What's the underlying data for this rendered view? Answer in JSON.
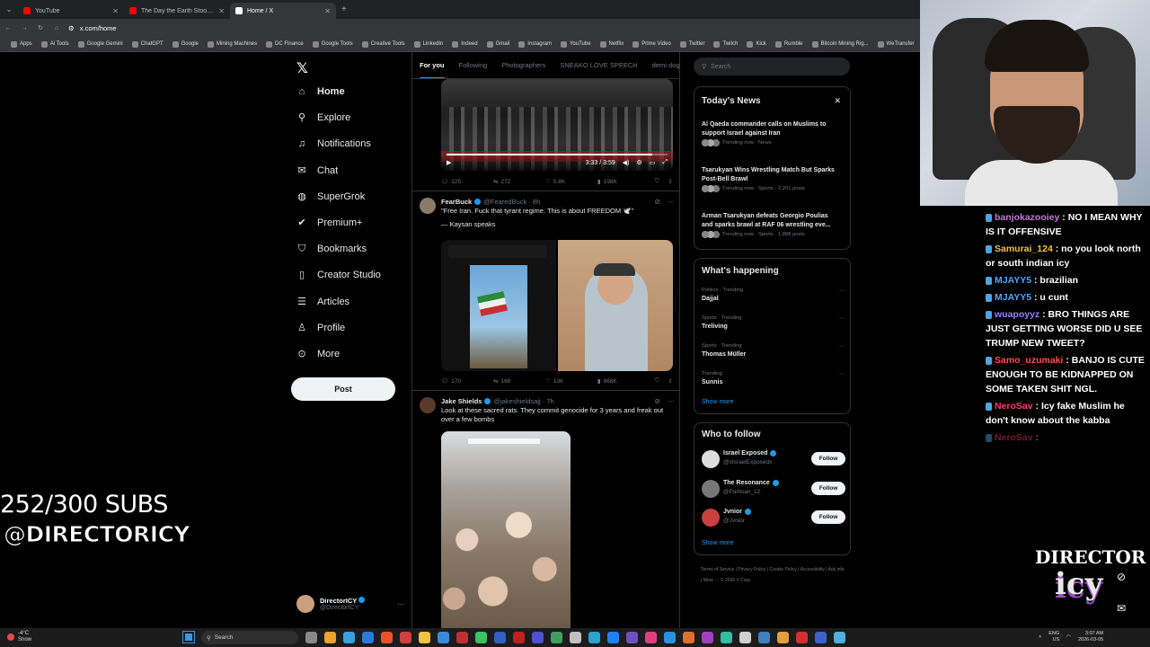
{
  "browser": {
    "tabs": [
      {
        "label": "YouTube",
        "color": "#ff0000",
        "active": false
      },
      {
        "label": "The Day the Earth Stood Still (2...",
        "color": "#ff0000",
        "active": false
      },
      {
        "label": "Home / X",
        "color": "#ffffff",
        "active": true
      }
    ],
    "url": "x.com/home",
    "bookmarks": [
      "Apps",
      "Ai Tools",
      "Google Gemini",
      "ChatGPT",
      "Google",
      "Mining Machines",
      "DC Finance",
      "Google Tools",
      "Creative Tools",
      "LinkedIn",
      "Indeed",
      "Gmail",
      "Instagram",
      "YouTube",
      "Netflix",
      "Prime Video",
      "Twitter",
      "Twitch",
      "Kick",
      "Rumble",
      "Bitcoin Mining Rig...",
      "WeTransfer"
    ]
  },
  "x": {
    "nav": [
      {
        "label": "Home",
        "icon": "home-icon",
        "glyph": "⌂"
      },
      {
        "label": "Explore",
        "icon": "search-icon",
        "glyph": "⚲"
      },
      {
        "label": "Notifications",
        "icon": "bell-icon",
        "glyph": "♫"
      },
      {
        "label": "Chat",
        "icon": "mail-icon",
        "glyph": "✉"
      },
      {
        "label": "SuperGrok",
        "icon": "grok-icon",
        "glyph": "◍"
      },
      {
        "label": "Premium+",
        "icon": "premium-icon",
        "glyph": "✔"
      },
      {
        "label": "Bookmarks",
        "icon": "bookmark-icon",
        "glyph": "⛉"
      },
      {
        "label": "Creator Studio",
        "icon": "creator-icon",
        "glyph": "▯"
      },
      {
        "label": "Articles",
        "icon": "articles-icon",
        "glyph": "☰"
      },
      {
        "label": "Profile",
        "icon": "profile-icon",
        "glyph": "♙"
      },
      {
        "label": "More",
        "icon": "more-icon",
        "glyph": "⊙"
      }
    ],
    "post_label": "Post",
    "account": {
      "name": "DirectorICY",
      "handle": "@DirectorICY"
    },
    "feed_tabs": [
      "For you",
      "Following",
      "Photographers",
      "SNEAKO LOVE SPEECH",
      "demi dog"
    ],
    "video1": {
      "time": "3:33 / 3:59",
      "progress": 0.93
    },
    "tweet1_actions": {
      "replies": "125",
      "reposts": "272",
      "likes": "5.8K",
      "views": "198K"
    },
    "tweet2": {
      "name": "FearBuck",
      "handle": "@FearedBuck · 8h",
      "text": "\"Free Iran. Fuck that tyrant regime. This is about FREEDOM 🕊️\"",
      "text2": "— Kaysan speaks",
      "actions": {
        "replies": "170",
        "reposts": "168",
        "likes": "10K",
        "views": "866K"
      }
    },
    "tweet3": {
      "name": "Jake Shields",
      "handle": "@jakeshieldsajj · 7h",
      "text": "Look at these sacred rats.  They commit genocide for 3 years and freak out over a few bombs"
    },
    "search_placeholder": "Search",
    "todays_news": {
      "title": "Today's News",
      "items": [
        {
          "title": "Al Qaeda commander calls on Muslims to support Israel against Iran",
          "meta": "Trending now · News"
        },
        {
          "title": "Tsarukyan Wins Wrestling Match But Sparks Post-Bell Brawl",
          "meta": "Trending now · Sports · 2,201 posts"
        },
        {
          "title": "Arman Tsarukyan defeats Georgio Poulias and sparks brawl at RAF 06 wrestling eve...",
          "meta": "Trending now · Sports · 1,888 posts"
        }
      ]
    },
    "whats_happening": {
      "title": "What's happening",
      "items": [
        {
          "category": "Politics · Trending",
          "topic": "Dajjal"
        },
        {
          "category": "Sports · Trending",
          "topic": "Treliving"
        },
        {
          "category": "Sports · Trending",
          "topic": "Thomas Müller"
        },
        {
          "category": "Trending",
          "topic": "Sunnis"
        }
      ],
      "show_more": "Show more"
    },
    "who_to_follow": {
      "title": "Who to follow",
      "items": [
        {
          "name": "Israel Exposed",
          "handle": "@xIsraelExposedx",
          "button": "Follow"
        },
        {
          "name": "The Resonance",
          "handle": "@Partisan_12",
          "button": "Follow"
        },
        {
          "name": "Jvnior",
          "handle": "@Jvnior",
          "button": "Follow"
        }
      ],
      "show_more": "Show more"
    },
    "footer": "Terms of Service  |  Privacy Policy  |  Cookie Policy  |  Accessibility  |  Ads info  |  More ···  © 2026 X Corp."
  },
  "stream": {
    "subs": "252/300 SUBS",
    "handle": "@DIRECTORICY",
    "chat": [
      {
        "user": "banjokazooiey",
        "user_color": "#c678dd",
        "text": "NO I MEAN WHY IS IT OFFENSIVE"
      },
      {
        "user": "Samurai_124",
        "user_color": "#f0c040",
        "text": "no you look north or south indian icy"
      },
      {
        "user": "MJAYY5",
        "user_color": "#4da6ff",
        "text": "brazilian"
      },
      {
        "user": "MJAYY5",
        "user_color": "#4da6ff",
        "text": "u cunt"
      },
      {
        "user": "wuapoyyz",
        "user_color": "#9b7dff",
        "text": "BRO THINGS ARE JUST GETTING WORSE DID U SEE TRUMP NEW TWEET?"
      },
      {
        "user": "Samo_uzumaki",
        "user_color": "#ff4d4d",
        "text": "BANJO IS CUTE ENOUGH TO BE KIDNAPPED ON SOME TAKEN SHIT NGL."
      },
      {
        "user": "NeroSav",
        "user_color": "#ff3b6b",
        "text": "Icy fake Muslim he don't know about the kabba"
      },
      {
        "user": "NeroSav",
        "user_color": "#ff3b6b",
        "text": ""
      }
    ],
    "logo_top": "DIRECTOR",
    "logo_bottom": "icy"
  },
  "taskbar": {
    "weather_temp": "-4°C",
    "weather_desc": "Snow",
    "search": "Search",
    "lang": "ENG",
    "region": "US",
    "time": "3:07 AM",
    "date": "2026-03-05"
  }
}
